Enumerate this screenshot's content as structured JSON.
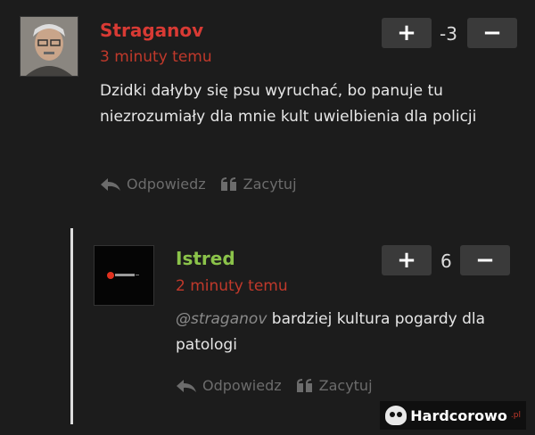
{
  "comments": [
    {
      "author": "Straganov",
      "time": "3 minuty temu",
      "text": "Dzidki dałyby się psu wyruchać, bo panuje tu niezrozumiały dla mnie kult uwielbienia dla policji",
      "score": "-3",
      "plus_label": "+",
      "minus_label": "−",
      "reply_label": "Odpowiedz",
      "quote_label": "Zacytuj",
      "author_color": "#d83a34"
    },
    {
      "author": "Istred",
      "time": "2 minuty temu",
      "mention": "@straganov",
      "text": " bardziej kultura pogardy dla patologi",
      "score": "6",
      "plus_label": "+",
      "minus_label": "−",
      "reply_label": "Odpowiedz",
      "quote_label": "Zacytuj",
      "author_color": "#8bc34a"
    }
  ],
  "watermark": {
    "text": "Hardcorowo",
    "tld": ".pl"
  },
  "colors": {
    "background": "#1c1c1c",
    "time": "#c0392b",
    "button": "#3a3a3a"
  }
}
